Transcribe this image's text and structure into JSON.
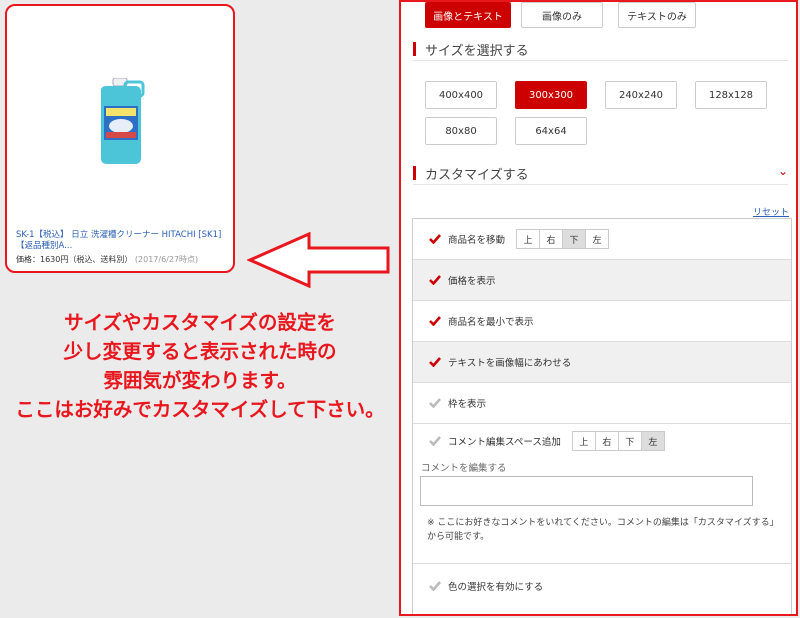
{
  "product": {
    "title_line1": "SK-1【税込】 日立 洗濯槽クリーナー HITACHI [SK1]",
    "title_line2": "【返品種別A...",
    "price": "価格：1630円（税込、送料別）",
    "timestamp": "(2017/6/27時点)"
  },
  "message": {
    "line1": "サイズやカスタマイズの設定を",
    "line2": "少し変更すると表示された時の",
    "line3": "雰囲気が変わります。",
    "line4": "ここはお好みでカスタマイズして下さい。"
  },
  "display_tabs": [
    {
      "label": "画像とテキスト",
      "active": true
    },
    {
      "label": "画像のみ",
      "active": false
    },
    {
      "label": "テキストのみ",
      "active": false
    }
  ],
  "size_section": {
    "title": "サイズを選択する",
    "sizes": [
      {
        "label": "400x400",
        "active": false
      },
      {
        "label": "300x300",
        "active": true
      },
      {
        "label": "240x240",
        "active": false
      },
      {
        "label": "128x128",
        "active": false
      },
      {
        "label": "80x80",
        "active": false
      },
      {
        "label": "64x64",
        "active": false
      }
    ]
  },
  "customize_section": {
    "title": "カスタマイズする",
    "reset": "リセット",
    "options": [
      {
        "label": "商品名を移動",
        "checked": true
      },
      {
        "label": "価格を表示",
        "checked": true
      },
      {
        "label": "商品名を最小で表示",
        "checked": true
      },
      {
        "label": "テキストを画像幅にあわせる",
        "checked": true
      },
      {
        "label": "枠を表示",
        "checked": false
      }
    ],
    "position_buttons": [
      "上",
      "右",
      "下",
      "左"
    ],
    "comment": {
      "label": "コメント編集スペース追加",
      "field_label": "コメントを編集する",
      "note": "※ ここにお好きなコメントをいれてください。コメントの編集は「カスタマイズする」から可能です。"
    },
    "color_option": "色の選択を有効にする"
  },
  "colors": {
    "accent": "#e8161d",
    "brand_red": "#c00000",
    "link": "#2b5fb5"
  }
}
